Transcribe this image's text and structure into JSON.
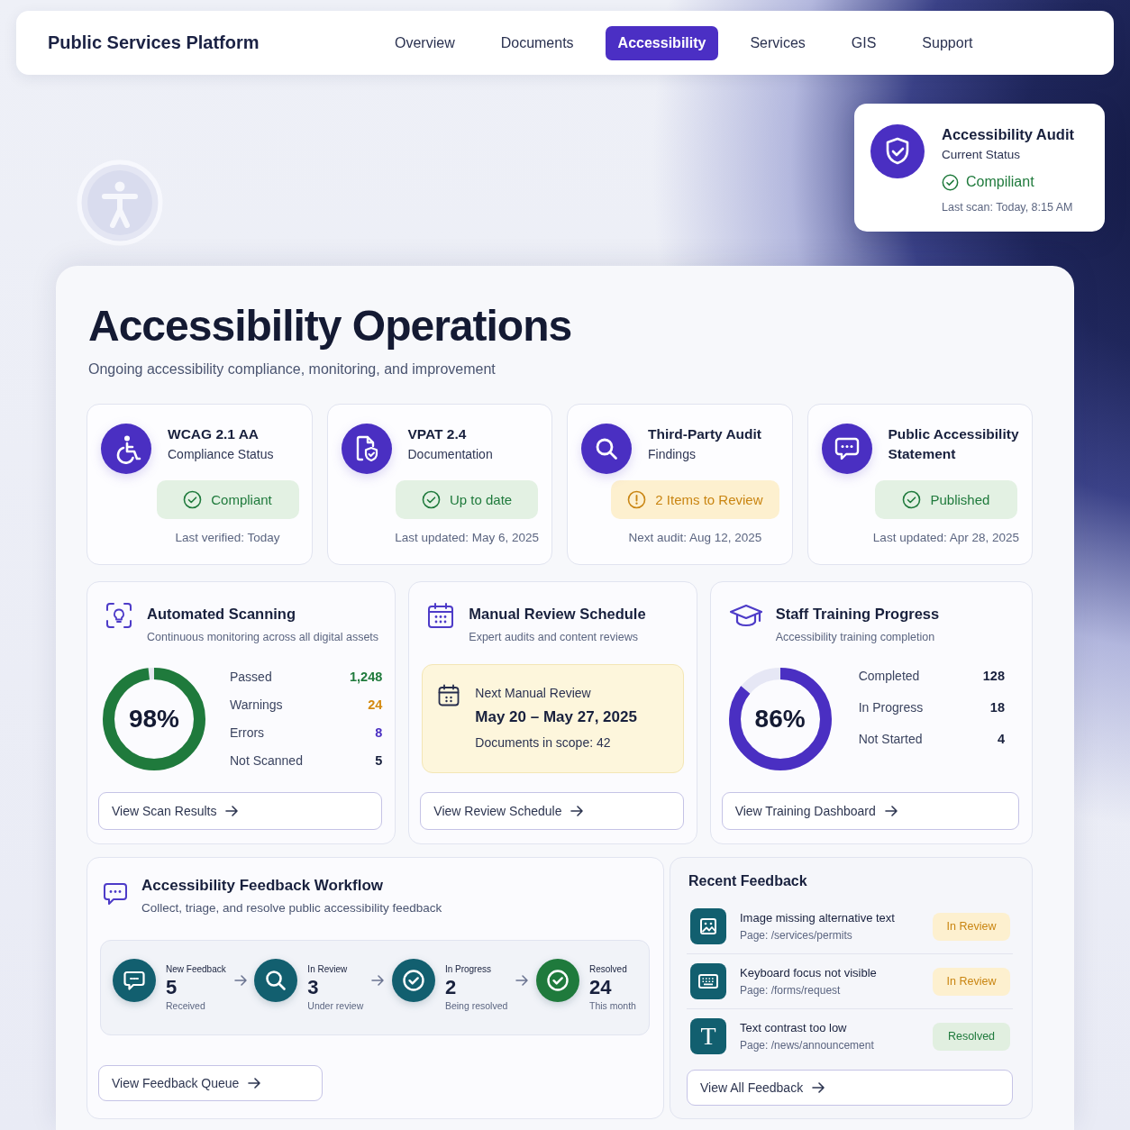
{
  "nav": {
    "brand": "Public Services Platform",
    "tabs": [
      {
        "label": "Overview",
        "selected": false
      },
      {
        "label": "Documents",
        "selected": false
      },
      {
        "label": "Accessibility",
        "selected": true
      },
      {
        "label": "Services",
        "selected": false
      },
      {
        "label": "GIS",
        "selected": false
      },
      {
        "label": "Support",
        "selected": false
      }
    ]
  },
  "audit_card": {
    "title": "Accessibility Audit",
    "subtitle": "Current Status",
    "status": {
      "label": "Compiliant",
      "kind": "success"
    },
    "last_scan": "Last scan: Today, 8:15 AM"
  },
  "page": {
    "title": "Accessibility Operations",
    "subtitle": "Ongoing accessibility compliance, monitoring, and improvement"
  },
  "status_cards": [
    {
      "title": "WCAG 2.1 AA",
      "subtitle": "Compliance Status",
      "badge": {
        "label": "Compliant",
        "kind": "success"
      },
      "footer": "Last verified: Today"
    },
    {
      "title": "VPAT 2.4",
      "subtitle": "Documentation",
      "badge": {
        "label": "Up to date",
        "kind": "success"
      },
      "footer": "Last updated: May 6, 2025"
    },
    {
      "title": "Third-Party Audit",
      "subtitle": "Findings",
      "badge": {
        "label": "2 Items to Review",
        "kind": "warning"
      },
      "footer": "Next audit: Aug 12, 2025"
    },
    {
      "title": "Public Accessibility Statement",
      "badge": {
        "label": "Published",
        "kind": "success"
      },
      "footer": "Last updated: Apr 28, 2025"
    }
  ],
  "scanning": {
    "title": "Automated Scanning",
    "subtitle": "Continuous monitoring across all digital assets",
    "progress": {
      "level": 0.98,
      "reading": "98%"
    },
    "stats": [
      {
        "label": "Passed",
        "value": "1,248",
        "color": "#1f7a3c"
      },
      {
        "label": "Warnings",
        "value": "24",
        "color": "#d48a10"
      },
      {
        "label": "Errors",
        "value": "8",
        "color": "#4a2fc2"
      },
      {
        "label": "Not Scanned",
        "value": "5",
        "color": "#18203d"
      }
    ],
    "button": "View Scan Results"
  },
  "review_schedule": {
    "title": "Manual Review Schedule",
    "subtitle": "Expert audits and content reviews",
    "next_review": {
      "label": "Next Manual Review",
      "dates": "May 20 – May 27, 2025",
      "scope": "Documents in scope: 42"
    },
    "button": "View Review Schedule"
  },
  "training": {
    "title": "Staff Training Progress",
    "subtitle": "Accessibility training completion",
    "progress": {
      "level": 0.86,
      "reading": "86%"
    },
    "stats": [
      {
        "label": "Completed",
        "value": "128"
      },
      {
        "label": "In Progress",
        "value": "18"
      },
      {
        "label": "Not Started",
        "value": "4"
      }
    ],
    "button": "View Training Dashboard"
  },
  "feedback_workflow": {
    "title": "Accessibility Feedback Workflow",
    "subtitle": "Collect, triage, and resolve public accessibility feedback",
    "steps": [
      {
        "label": "New Feedback",
        "count": "5",
        "note": "Received",
        "color": "#125f6f"
      },
      {
        "label": "In Review",
        "count": "3",
        "note": "Under review",
        "color": "#125f6f"
      },
      {
        "label": "In Progress",
        "count": "2",
        "note": "Being resolved",
        "color": "#125f6f"
      },
      {
        "label": "Resolved",
        "count": "24",
        "note": "This month",
        "color": "#1f7a3c"
      }
    ],
    "button": "View Feedback Queue"
  },
  "recent_feedback": {
    "title": "Recent Feedback",
    "items": [
      {
        "title": "Image missing alternative text",
        "page": "Page: /services/permits",
        "status": {
          "label": "In Review",
          "kind": "warning"
        }
      },
      {
        "title": "Keyboard focus not visible",
        "page": "Page: /forms/request",
        "status": {
          "label": "In Review",
          "kind": "warning"
        }
      },
      {
        "title": "Text contrast too low",
        "page": "Page: /news/announcement",
        "icon_glyph": "T",
        "status": {
          "label": "Resolved",
          "kind": "success"
        }
      }
    ],
    "button": "View All Feedback"
  }
}
